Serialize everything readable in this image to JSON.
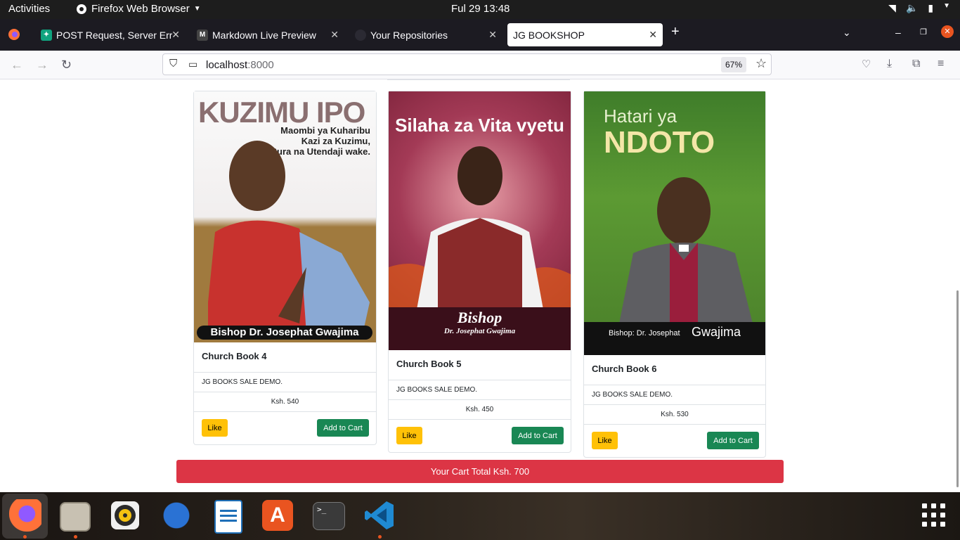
{
  "topbar": {
    "activities": "Activities",
    "app_name": "Firefox Web Browser",
    "clock": "Ful 29  13:48"
  },
  "tabs": [
    {
      "title": "POST Request, Server Err",
      "icon": "chatgpt-icon"
    },
    {
      "title": "Markdown Live Preview",
      "icon": "markdown-m-icon"
    },
    {
      "title": "Your Repositories",
      "icon": "github-icon"
    },
    {
      "title": "JG BOOKSHOP",
      "icon": "none"
    }
  ],
  "navbar": {
    "url_host": "localhost",
    "url_port": ":8000",
    "zoom": "67%"
  },
  "books": [
    {
      "cover_headline": "KUZIMU IPO",
      "cover_tagline": [
        "Maombi ya Kuharibu",
        "Kazi za Kuzimu,",
        "Sura na Utendaji wake."
      ],
      "cover_author": "Bishop Dr. Josephat Gwajima",
      "title": "Church Book 4",
      "description": "JG BOOKS SALE DEMO.",
      "price": "Ksh. 540",
      "like_label": "Like",
      "cart_label": "Add to Cart"
    },
    {
      "cover_headline": "Silaha za Vita vyetu",
      "cover_author_title": "Bishop",
      "cover_author": "Dr. Josephat Gwajima",
      "title": "Church Book 5",
      "description": "JG BOOKS SALE DEMO.",
      "price": "Ksh. 450",
      "like_label": "Like",
      "cart_label": "Add to Cart"
    },
    {
      "cover_headline_small": "Hatari ya",
      "cover_headline": "NDOTO",
      "cover_author": "Bishop: Dr. Josephat",
      "cover_author_last": "Gwajima",
      "title": "Church Book 6",
      "description": "JG BOOKS SALE DEMO.",
      "price": "Ksh. 530",
      "like_label": "Like",
      "cart_label": "Add to Cart"
    }
  ],
  "cart_total": "Your Cart Total Ksh. 700",
  "dock": [
    "firefox-icon",
    "files-icon",
    "rhythmbox-icon",
    "thunderbird-icon",
    "writer-icon",
    "app-center-icon",
    "terminal-icon",
    "vscode-icon",
    "show-apps-icon"
  ],
  "colors": {
    "like": "#ffc107",
    "cart": "#198754",
    "total": "#dc3545"
  }
}
